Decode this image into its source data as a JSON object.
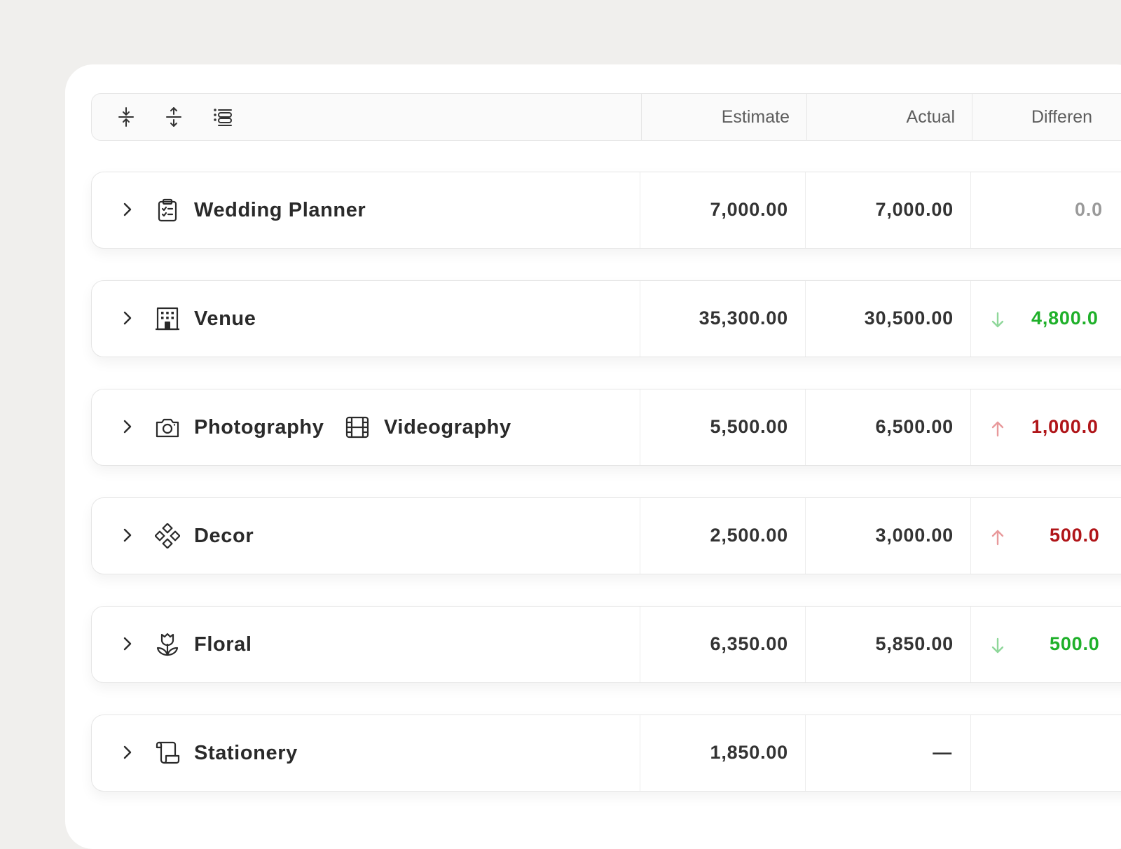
{
  "header": {
    "tools": [
      {
        "icon": "collapse-all-icon"
      },
      {
        "icon": "expand-all-icon"
      },
      {
        "icon": "list-indent-icon"
      }
    ],
    "columns": {
      "estimate": "Estimate",
      "actual": "Actual",
      "difference": "Differen"
    }
  },
  "rows": [
    {
      "label": "Wedding Planner",
      "label2": "",
      "icon": "clipboard-check-icon",
      "estimate": "7,000.00",
      "actual": "7,000.00",
      "difference": "0.0",
      "trend": "none"
    },
    {
      "label": "Venue",
      "label2": "",
      "icon": "building-icon",
      "estimate": "35,300.00",
      "actual": "30,500.00",
      "difference": "4,800.0",
      "trend": "down"
    },
    {
      "label": "Photography",
      "label2": "Videography",
      "icon": "camera-icon",
      "icon2": "film-icon",
      "estimate": "5,500.00",
      "actual": "6,500.00",
      "difference": "1,000.0",
      "trend": "up"
    },
    {
      "label": "Decor",
      "label2": "",
      "icon": "diamonds-icon",
      "estimate": "2,500.00",
      "actual": "3,000.00",
      "difference": "500.0",
      "trend": "up"
    },
    {
      "label": "Floral",
      "label2": "",
      "icon": "tulip-icon",
      "estimate": "6,350.00",
      "actual": "5,850.00",
      "difference": "500.0",
      "trend": "down"
    },
    {
      "label": "Stationery",
      "label2": "",
      "icon": "scroll-icon",
      "estimate": "1,850.00",
      "actual": "—",
      "difference": "",
      "trend": "none"
    }
  ],
  "colors": {
    "positive": "#1fb02a",
    "negative": "#b01519",
    "neutral": "#9a9a9a",
    "arrow_down": "#8fd79a",
    "arrow_up": "#e8999b"
  }
}
